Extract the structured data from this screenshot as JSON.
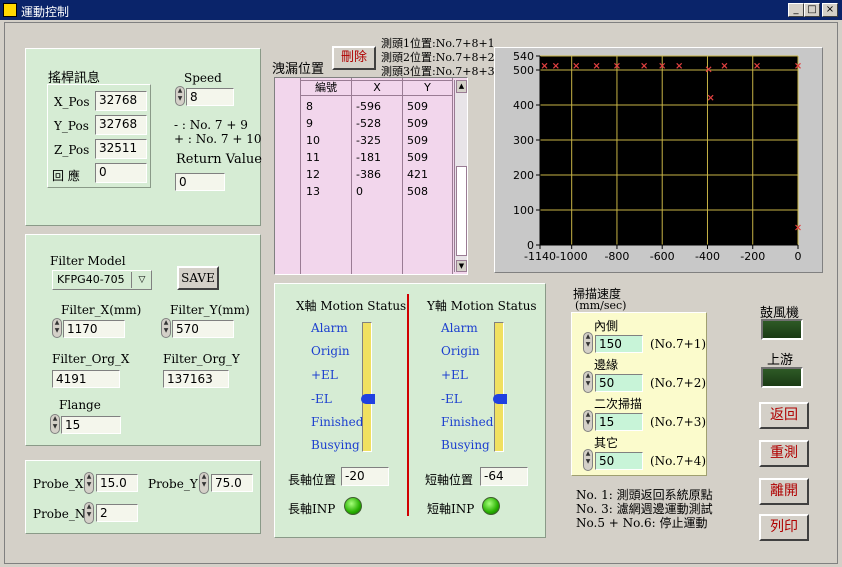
{
  "window": {
    "title": "運動控制",
    "min": "_",
    "max": "□",
    "close": "×"
  },
  "joystick": {
    "title": "搖桿訊息",
    "x_label": "X_Pos",
    "x_value": "32768",
    "y_label": "Y_Pos",
    "y_value": "32768",
    "z_label": "Z_Pos",
    "z_value": "32511",
    "resp_label": "回  應",
    "resp_value": "0",
    "speed_label": "Speed",
    "speed_value": "8",
    "hint1": "- : No. 7 + 9",
    "hint2": "+ : No. 7 + 10",
    "return_label": "Return Value",
    "return_value": "0"
  },
  "filter": {
    "model_label": "Filter Model",
    "model_value": "KFPG40-705",
    "save": "SAVE",
    "fx_label": "Filter_X(mm)",
    "fx_value": "1170",
    "fy_label": "Filter_Y(mm)",
    "fy_value": "570",
    "ox_label": "Filter_Org_X",
    "ox_value": "4191",
    "oy_label": "Filter_Org_Y",
    "oy_value": "137163",
    "flange_label": "Flange",
    "flange_value": "15"
  },
  "probe": {
    "x_label": "Probe_X",
    "x_value": "15.0",
    "y_label": "Probe_Y",
    "y_value": "75.0",
    "n_label": "Probe_N",
    "n_value": "2"
  },
  "leak": {
    "label": "洩漏位置",
    "delete": "刪除",
    "info1": "測頭1位置:No.7+8+1",
    "info2": "測頭2位置:No.7+8+2",
    "info3": "測頭3位置:No.7+8+3",
    "headers": [
      "編號",
      "X",
      "Y"
    ],
    "rows": [
      [
        "8",
        "-596",
        "509"
      ],
      [
        "9",
        "-528",
        "509"
      ],
      [
        "10",
        "-325",
        "509"
      ],
      [
        "11",
        "-181",
        "509"
      ],
      [
        "12",
        "-386",
        "421"
      ],
      [
        "13",
        "0",
        "508"
      ]
    ]
  },
  "chart_data": {
    "type": "scatter",
    "xlim": [
      -1140,
      0
    ],
    "ylim": [
      0,
      540
    ],
    "xticks": [
      "-1140",
      "-1000",
      "-800",
      "-600",
      "-400",
      "-200",
      "0"
    ],
    "yticks": [
      "0",
      "100",
      "200",
      "300",
      "400",
      "500",
      "540"
    ],
    "points": [
      {
        "x": -1120,
        "y": 512
      },
      {
        "x": -1070,
        "y": 512
      },
      {
        "x": -980,
        "y": 512
      },
      {
        "x": -890,
        "y": 512
      },
      {
        "x": -800,
        "y": 512
      },
      {
        "x": -680,
        "y": 512
      },
      {
        "x": -600,
        "y": 512
      },
      {
        "x": -525,
        "y": 512
      },
      {
        "x": -395,
        "y": 502
      },
      {
        "x": -325,
        "y": 512
      },
      {
        "x": -181,
        "y": 512
      },
      {
        "x": 0,
        "y": 512
      },
      {
        "x": -386,
        "y": 421
      },
      {
        "x": 0,
        "y": 50
      }
    ],
    "grid": true,
    "colors": {
      "background": "#000000",
      "grid": "#c8b446",
      "marker": "#e04040"
    }
  },
  "motion": {
    "x_title": "X軸 Motion Status",
    "y_title": "Y軸 Motion Status",
    "states": [
      "Alarm",
      "Origin",
      "+EL",
      "-EL",
      "Finished",
      "Busying"
    ],
    "x_slider_level": 0.4,
    "y_slider_level": 0.4,
    "long_pos_label": "長軸位置",
    "long_pos_value": "-20",
    "short_pos_label": "短軸位置",
    "short_pos_value": "-64",
    "long_inp_label": "長軸INP",
    "short_inp_label": "短軸INP"
  },
  "scan": {
    "title": "掃描速度",
    "unit": "(mm/sec)",
    "items": [
      {
        "label": "內側",
        "value": "150",
        "note": "(No.7+1)"
      },
      {
        "label": "邊緣",
        "value": "50",
        "note": "(No.7+2)"
      },
      {
        "label": "二次掃描",
        "value": "15",
        "note": "(No.7+3)"
      },
      {
        "label": "其它",
        "value": "50",
        "note": "(No.7+4)"
      }
    ]
  },
  "notes": {
    "n1": "No. 1: 測頭返回系統原點",
    "n2": "No. 3: 濾網週邊運動測試",
    "n3": "No.5 + No.6: 停止運動"
  },
  "right": {
    "blower_label": "鼓風機",
    "upstream_label": "上游",
    "btn_return": "返回",
    "btn_retest": "重測",
    "btn_leave": "離開",
    "btn_print": "列印"
  }
}
